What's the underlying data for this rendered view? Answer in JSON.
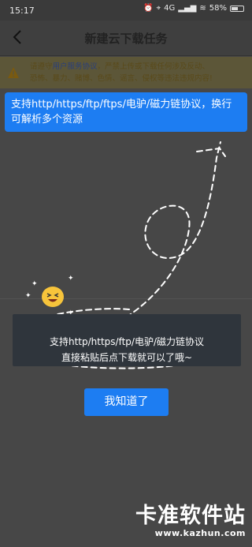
{
  "status_bar": {
    "time": "15:17",
    "network_label": "4G",
    "battery_text": "58%",
    "battery_level": 0.58
  },
  "header": {
    "title": "新建云下载任务"
  },
  "notice": {
    "prefix": "请遵守",
    "link_text": "用户服务协议",
    "rest_line1": "，严禁上传或下载任何涉及反动、",
    "line2": "恐怖、暴力、赌博、色情、谣言、侵权等违法违规内容!"
  },
  "tip": {
    "text": "支持http/https/ftp/ftps/电驴/磁力链协议，换行可解析多个资源"
  },
  "guide": {
    "line1": "支持http/https/ftp/电驴/磁力链协议",
    "line2": "直接粘贴后点下载就可以了哦~",
    "ok_button": "我知道了"
  },
  "watermark": {
    "name": "卡准软件站",
    "url": "www.kazhun.com"
  },
  "colors": {
    "accent": "#1d7df2",
    "overlay": "#454545"
  }
}
